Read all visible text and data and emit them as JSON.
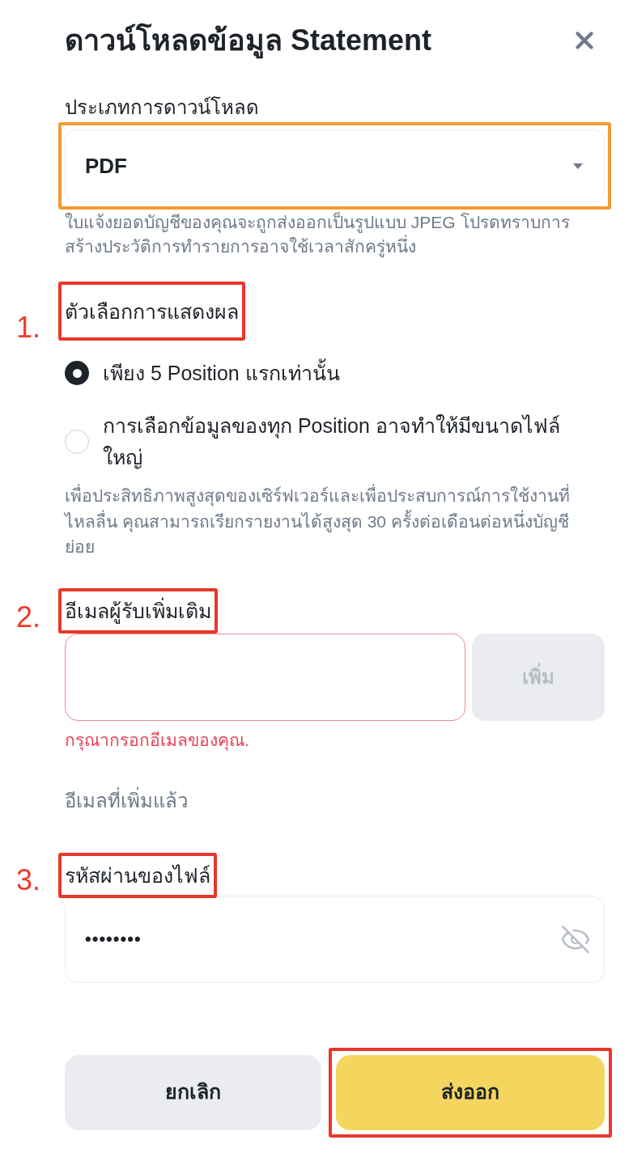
{
  "dialog": {
    "title": "ดาวน์โหลดข้อมูล Statement"
  },
  "download_type": {
    "label": "ประเภทการดาวน์โหลด",
    "value": "PDF",
    "highlighted": true,
    "hint": "ใบแจ้งยอดบัญชีของคุณจะถูกส่งออกเป็นรูปแบบ JPEG โปรดทราบการสร้างประวัติการทำรายการอาจใช้เวลาสักครู่หนึ่ง"
  },
  "display_options": {
    "step": "1.",
    "label": "ตัวเลือกการแสดงผล",
    "highlighted": true,
    "options": [
      {
        "label": "เพียง 5 Position แรกเท่านั้น",
        "selected": true
      },
      {
        "label": "การเลือกข้อมูลของทุก Position อาจทำให้มีขนาดไฟล์ใหญ่",
        "selected": false
      }
    ],
    "note": "เพื่อประสิทธิภาพสูงสุดของเซิร์ฟเวอร์และเพื่อประสบการณ์การใช้งานที่ไหลลื่น คุณสามารถเรียกรายงานได้สูงสุด 30 ครั้งต่อเดือนต่อหนึ่งบัญชีย่อย"
  },
  "recipient_email": {
    "step": "2.",
    "label": "อีเมลผู้รับเพิ่มเติม",
    "highlighted": true,
    "error": true,
    "add_button": {
      "label": "เพิ่ม",
      "disabled": true
    },
    "error_message": "กรุณากรอกอีเมลของคุณ.",
    "added_label": "อีเมลที่เพิ่มแล้ว"
  },
  "file_password": {
    "step": "3.",
    "label": "รหัสผ่านของไฟล์",
    "highlighted": true,
    "value": "••••••••",
    "visible": false
  },
  "buttons": [
    {
      "kind": "secondary",
      "label": "ยกเลิก"
    },
    {
      "kind": "primary",
      "label": "ส่งออก",
      "highlighted": true
    }
  ]
}
